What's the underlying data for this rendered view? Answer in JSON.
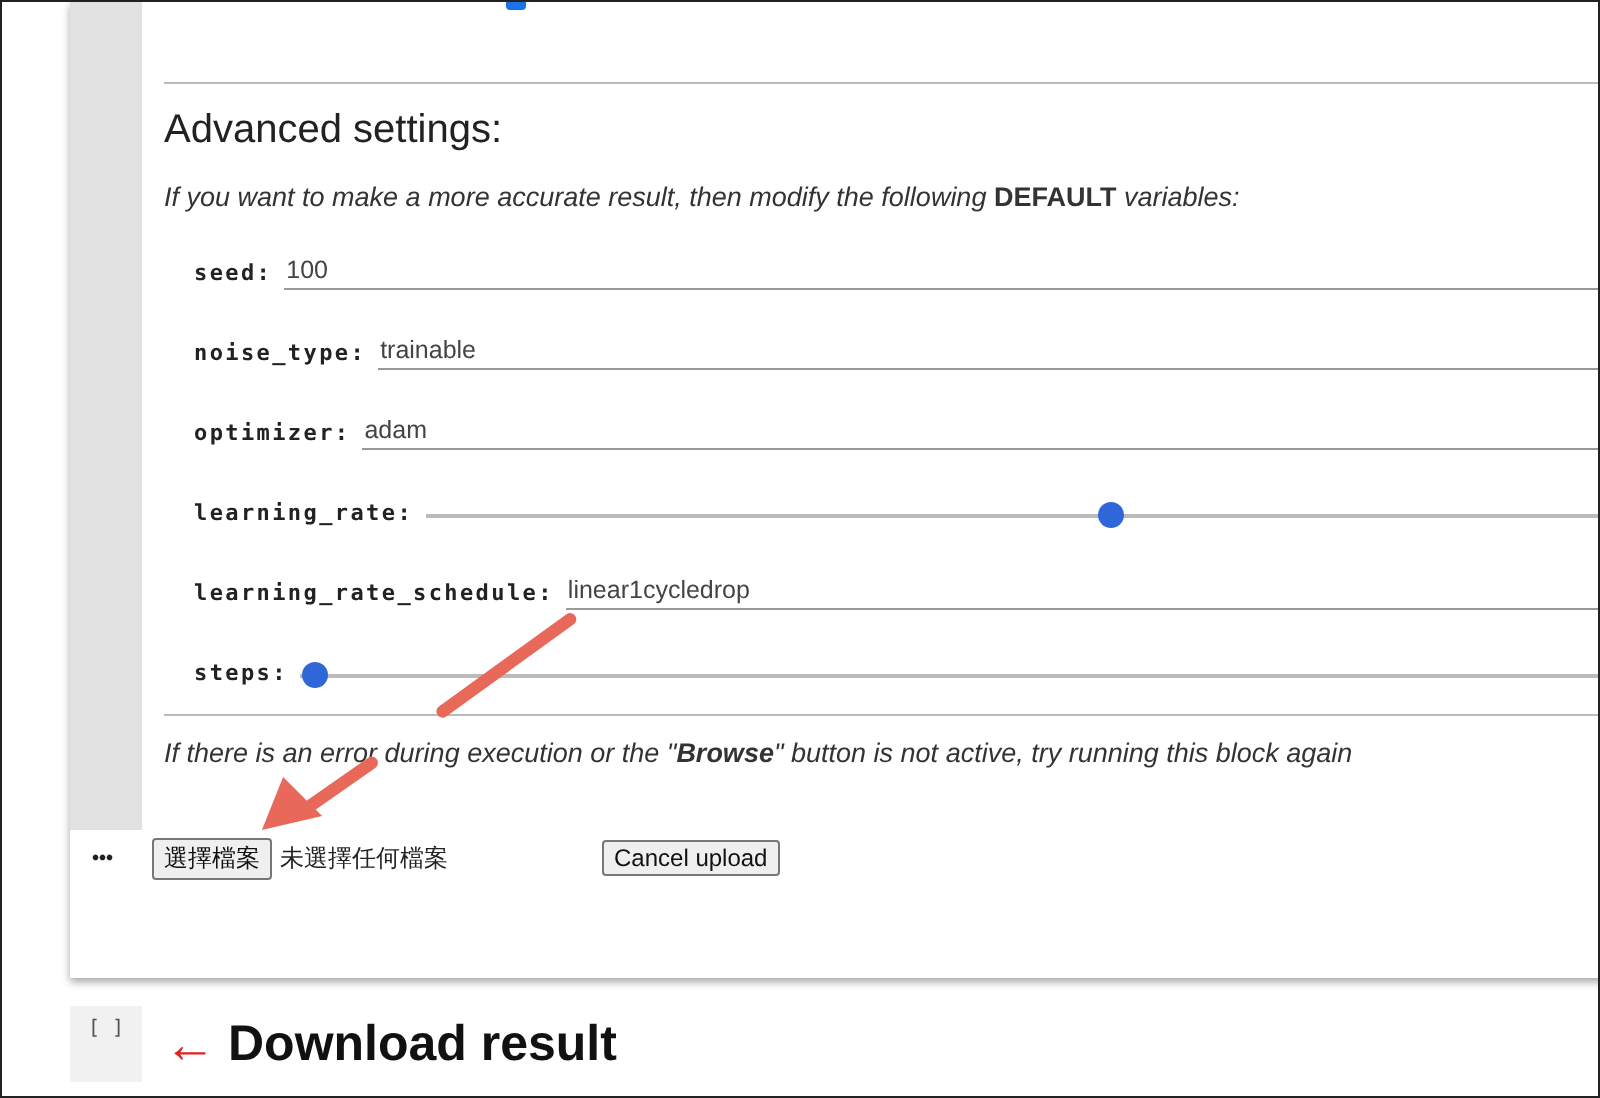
{
  "top_option": {
    "checked": true
  },
  "section": {
    "title": "Advanced settings:",
    "intro": "If you want to make a more accurate result, then modify the following **DEFAULT** variables:"
  },
  "params": [
    {
      "kind": "text",
      "label": "seed:",
      "value": "100"
    },
    {
      "kind": "text",
      "label": "noise_type:",
      "value": "trainable"
    },
    {
      "kind": "text",
      "label": "optimizer:",
      "value": "adam"
    },
    {
      "kind": "slider",
      "label": "learning_rate:",
      "level": 0.57
    },
    {
      "kind": "text",
      "label": "learning_rate_schedule:",
      "value": "linear1cycledrop"
    },
    {
      "kind": "slider",
      "label": "steps:",
      "level": 0
    }
  ],
  "note": "If there is an error during execution or the \"**Browse**\" button is not active, try running this block again",
  "upload": {
    "menu": "•••",
    "choose_button": "選擇檔案",
    "file_status": "未選擇任何檔案",
    "cancel_button": "Cancel upload"
  },
  "next_cell": {
    "run_marker": "[ ]",
    "arrow": "←",
    "title": "Download result"
  }
}
